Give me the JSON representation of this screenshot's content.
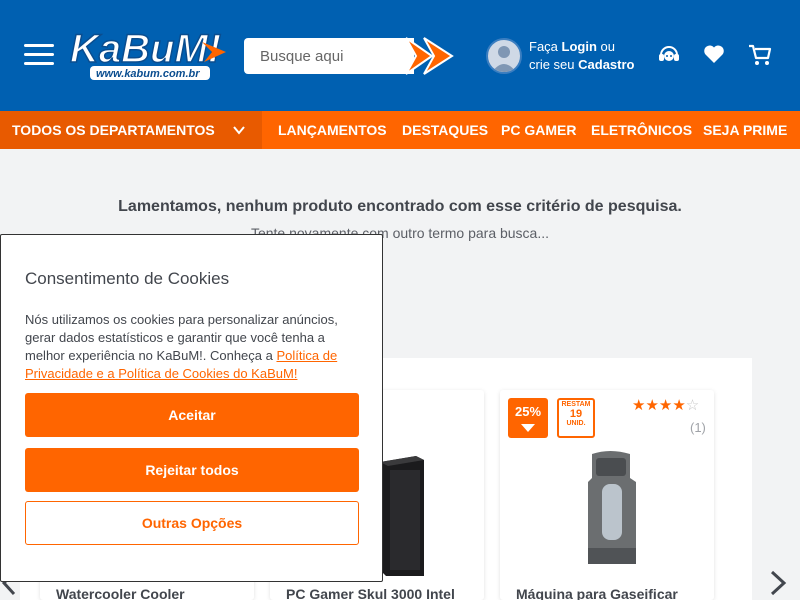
{
  "header": {
    "logo_text": "KaBuM!",
    "logo_url_text": "www.kabum.com.br",
    "search": {
      "placeholder": "Busque aqui"
    },
    "user": {
      "line1_prefix": "Faça ",
      "login_label": "Login",
      "line1_suffix": " ou",
      "line2_prefix": "crie seu ",
      "register_label": "Cadastro"
    },
    "icons": [
      "support-icon",
      "heart-icon",
      "cart-icon"
    ]
  },
  "nav": {
    "departments_label": "TODOS OS DEPARTAMENTOS",
    "items": [
      {
        "label": "LANÇAMENTOS"
      },
      {
        "label": "DESTAQUES"
      },
      {
        "label": "PC GAMER"
      },
      {
        "label": "ELETRÔNICOS"
      },
      {
        "label": "SEJA PRIME"
      }
    ]
  },
  "main": {
    "no_results": "Lamentamos, nenhum produto encontrado com esse critério de pesquisa.",
    "suggestion": "Tente novamente com outro termo para busca..."
  },
  "products": [
    {
      "title": "Watercooler Cooler"
    },
    {
      "title": "PC Gamer Skul 3000 Intel"
    },
    {
      "title": "Máquina para Gaseificar",
      "discount": "25%",
      "remaining_label": "RESTAM",
      "remaining_count": "19",
      "remaining_unit": "UNID.",
      "rating": 4,
      "reviews": "(1)"
    }
  ],
  "cookie": {
    "title": "Consentimento de Cookies",
    "text": "Nós utilizamos os cookies para personalizar anúncios, gerar dados estatísticos e garantir que você tenha a melhor experiência no KaBuM!. Conheça a ",
    "link": "Política de Privacidade e a Política de Cookies do KaBuM!",
    "accept": "Aceitar",
    "reject": "Rejeitar todos",
    "options": "Outras Opções"
  },
  "colors": {
    "header_blue": "#0060b1",
    "accent_orange": "#ff6500",
    "background": "#f2f3f4"
  }
}
